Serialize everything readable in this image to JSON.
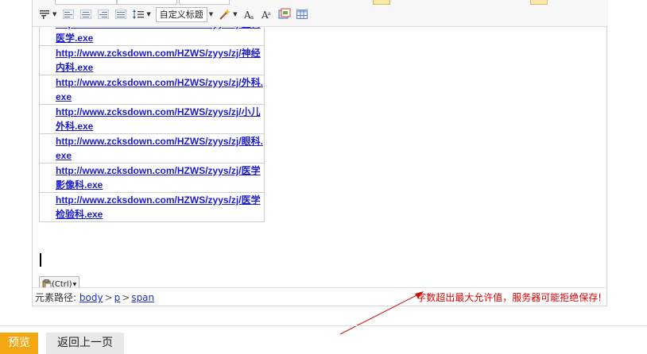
{
  "toolbar": {
    "heading_select": "自定义标题",
    "icons": [
      "paragraph-format-icon",
      "align-left-icon",
      "align-center-icon",
      "align-right-icon",
      "justify-icon",
      "line-height-icon",
      "magic-wand-icon",
      "font-size-icon",
      "font-family-icon",
      "image-icon",
      "table-icon"
    ]
  },
  "content": {
    "links": [
      {
        "text": "http://www.zcksdown.com/HZWS/zyys/zj/全科医学.exe"
      },
      {
        "text": "http://www.zcksdown.com/HZWS/zyys/zj/神经内科.exe"
      },
      {
        "text": "http://www.zcksdown.com/HZWS/zyys/zj/外科.exe"
      },
      {
        "text": "http://www.zcksdown.com/HZWS/zyys/zj/小儿外科.exe"
      },
      {
        "text": "http://www.zcksdown.com/HZWS/zyys/zj/眼科.exe"
      },
      {
        "text": "http://www.zcksdown.com/HZWS/zyys/zj/医学影像科.exe"
      },
      {
        "text": "http://www.zcksdown.com/HZWS/zyys/zj/医学检验科.exe"
      }
    ],
    "paste_label": "(Ctrl)"
  },
  "status": {
    "path_label": "元素路径:",
    "path": [
      "body",
      "p",
      "span"
    ],
    "path_sep": ">",
    "warning": "字数超出最大允许值，服务器可能拒绝保存!"
  },
  "buttons": {
    "preview": "预览",
    "back": "返回上一页"
  },
  "colors": {
    "link": "#1a1acf",
    "warning": "#e00000",
    "preview_bg": "#f3a712"
  }
}
